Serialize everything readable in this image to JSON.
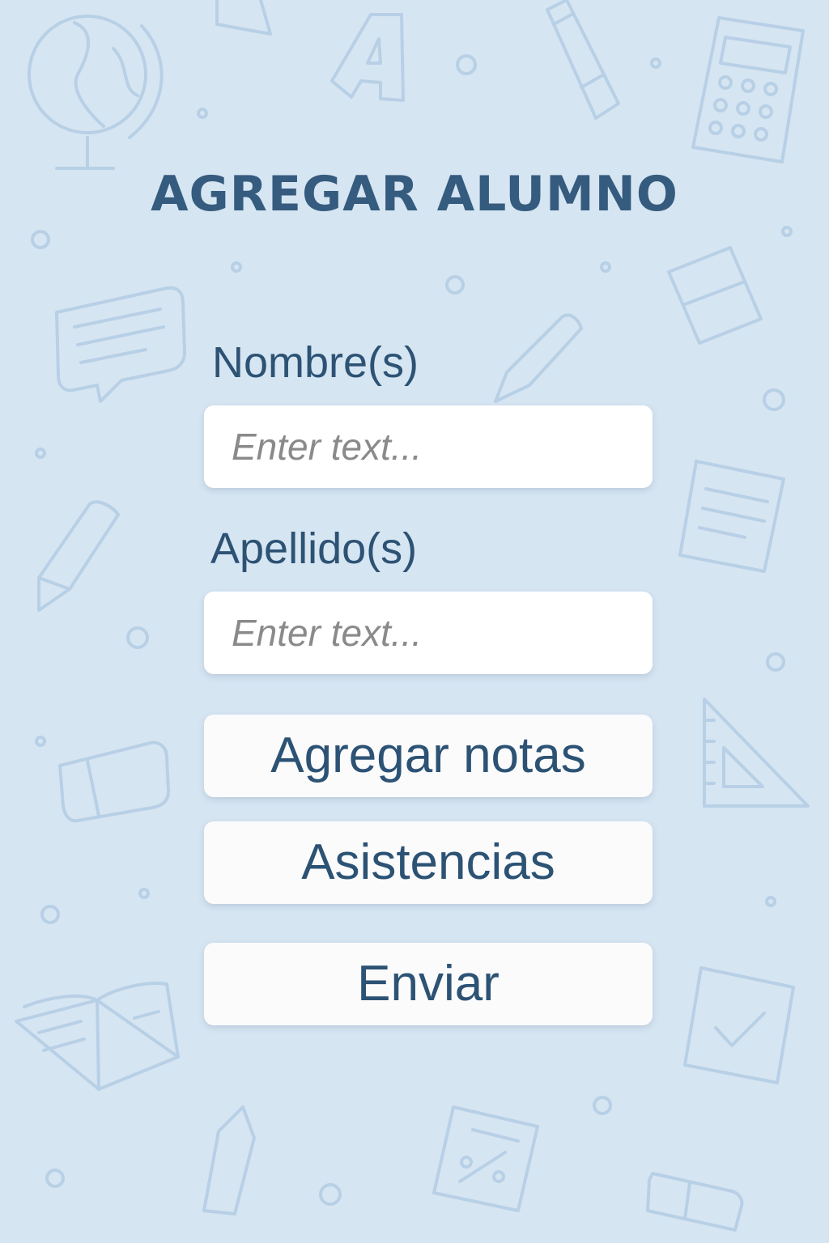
{
  "page": {
    "title": "AGREGAR ALUMNO"
  },
  "form": {
    "first_name": {
      "label": "Nombre(s)",
      "value": "",
      "placeholder": "Enter text..."
    },
    "last_name": {
      "label": "Apellido(s)",
      "value": "",
      "placeholder": "Enter text..."
    }
  },
  "actions": {
    "add_grades_label": "Agregar notas",
    "attendance_label": "Asistencias",
    "submit_label": "Enviar"
  },
  "background": {
    "doodle_icons": [
      "globe-icon",
      "ruler-triangle-icon",
      "letter-a-icon",
      "pencil-icon",
      "calculator-icon",
      "chat-bubble-icon",
      "eraser-icon",
      "notebook-icon",
      "set-square-icon",
      "open-book-icon",
      "checkbox-icon",
      "percent-sheet-icon"
    ]
  },
  "colors": {
    "background": "#d6e5f2",
    "title": "#355b7e",
    "text": "#2c5274",
    "field_background": "#ffffff",
    "placeholder": "#8a8a8a",
    "doodle_stroke": "#b8d0e6"
  }
}
